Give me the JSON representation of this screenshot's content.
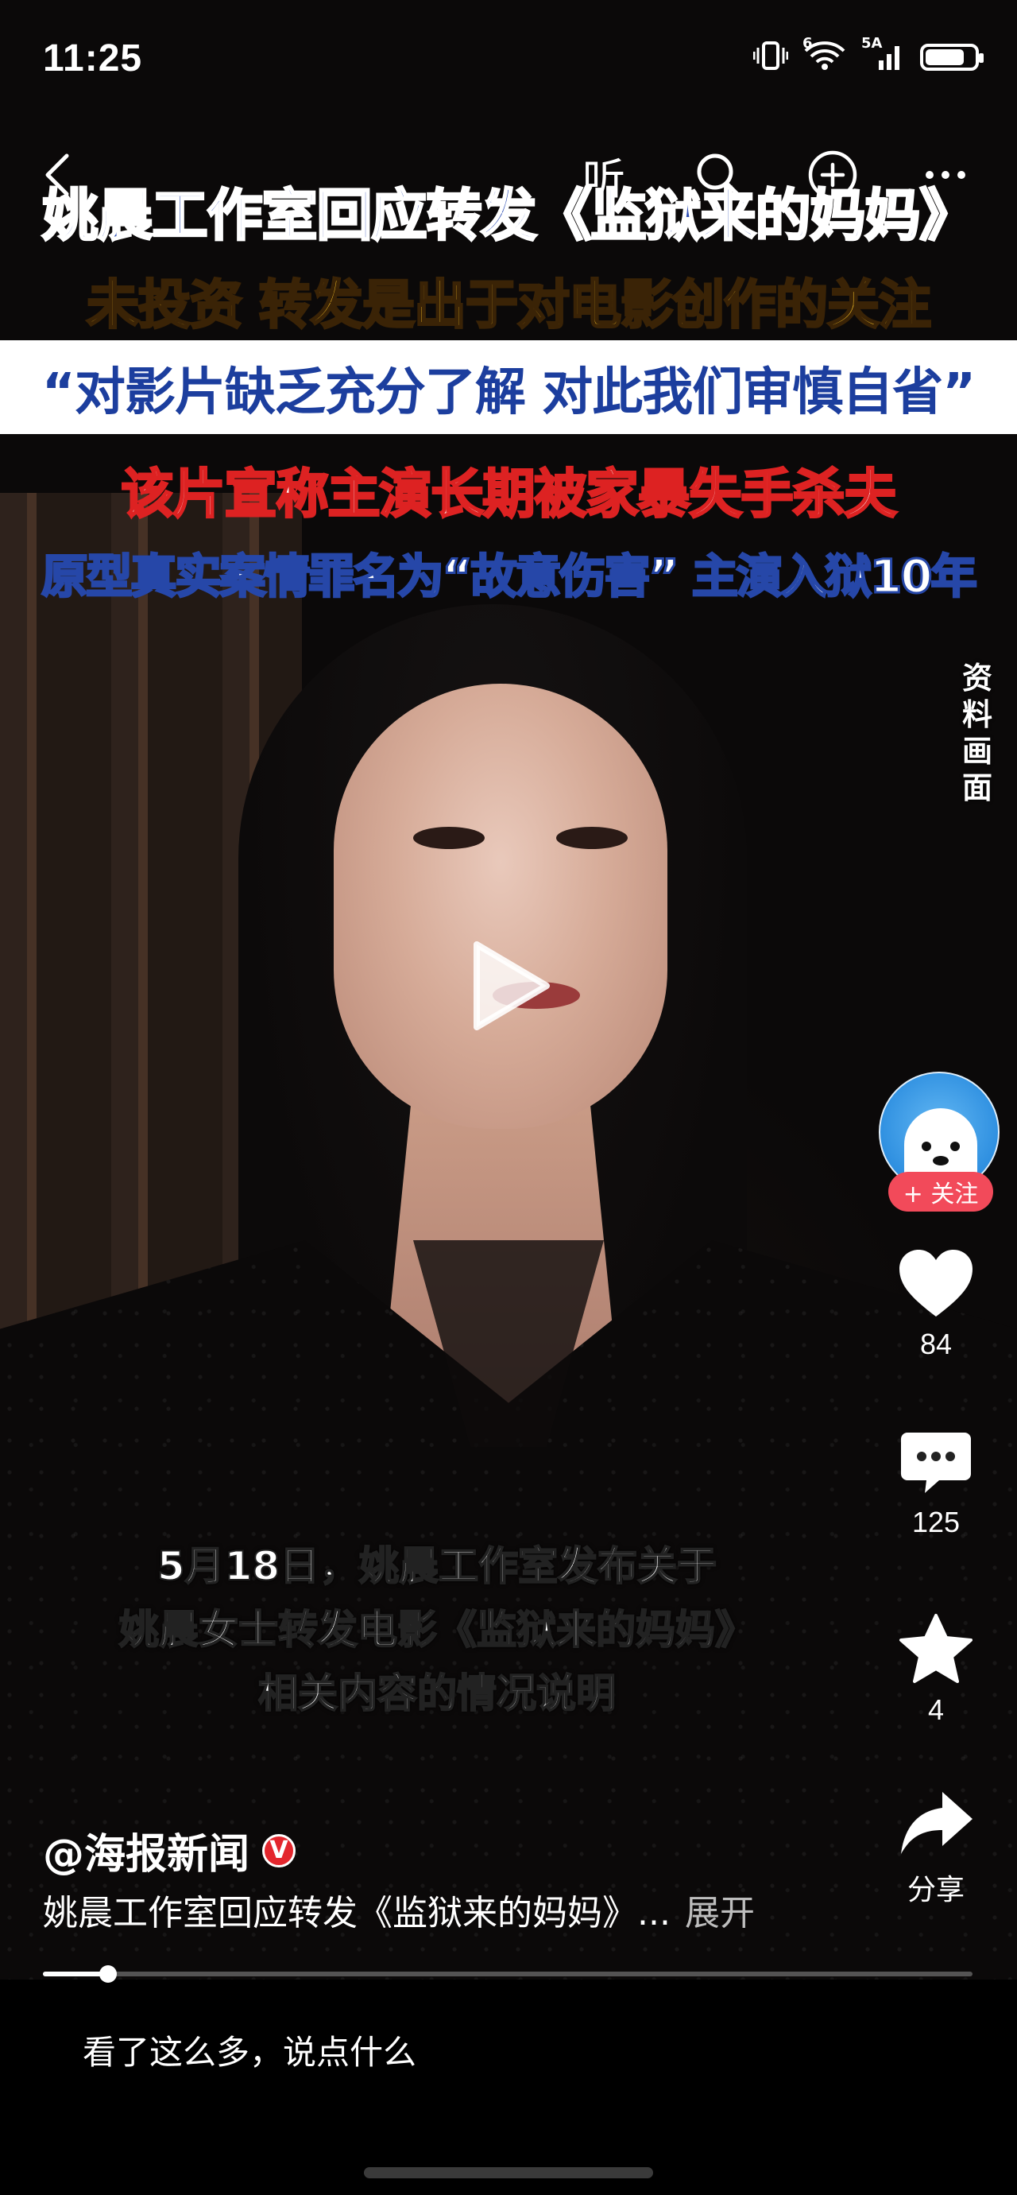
{
  "status_bar": {
    "time": "11:25",
    "signal_label": "5A",
    "wifi_label": "6",
    "battery_percent": 80
  },
  "top_nav": {
    "back_icon": "back-arrow-icon",
    "listen_label": "听",
    "search_icon": "search-icon",
    "add_icon": "add-circle-icon",
    "more_icon": "more-icon"
  },
  "video_overlay": {
    "headline1": "姚晨工作室回应转发《监狱来的妈妈》",
    "headline2": "未投资 转发是出于对电影创作的关注",
    "headline3": "“对影片缺乏充分了解 对此我们审慎自省”",
    "headline4": "该片宣称主演长期被家暴失手杀夫",
    "headline5": "原型真实案情罪名为“故意伤害” 主演入狱10年",
    "side_label": "资料画面",
    "caption1": "5月18日，姚晨工作室发布关于",
    "caption2": "姚晨女士转发电影《监狱来的妈妈》",
    "caption3": "相关内容的情况说明"
  },
  "actions": {
    "follow_label": "+ 关注",
    "like_count": "84",
    "comment_count": "125",
    "favorite_count": "4",
    "share_label": "分享"
  },
  "post": {
    "author": "@海报新闻",
    "verified_badge": "V",
    "description": "姚晨工作室回应转发《监狱来的妈妈》...",
    "expand_label": "展开"
  },
  "playback": {
    "progress": 0.07
  },
  "comment_bar": {
    "placeholder": "看了这么多，说点什么"
  }
}
